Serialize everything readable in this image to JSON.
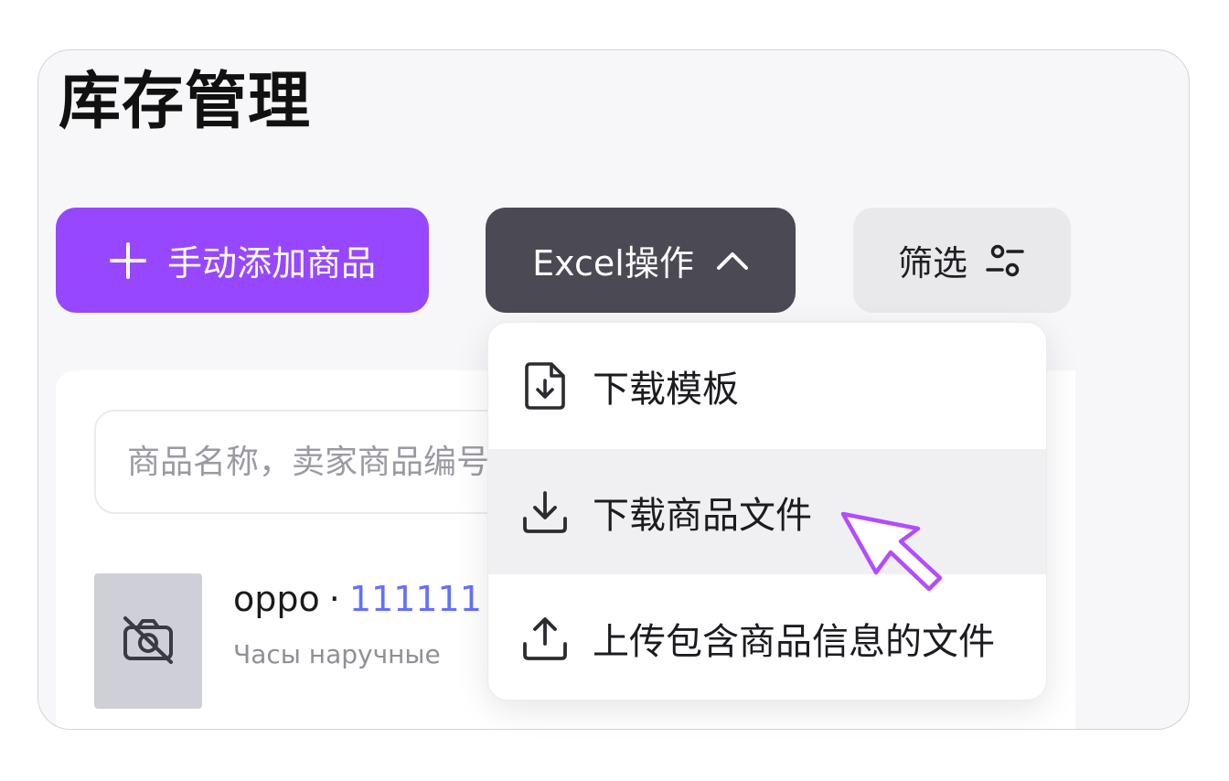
{
  "page": {
    "title": "库存管理"
  },
  "toolbar": {
    "add_label": "手动添加商品",
    "excel_label": "Excel操作",
    "filter_label": "筛选"
  },
  "search": {
    "placeholder": "商品名称，卖家商品编号，商品编号"
  },
  "product": {
    "name": "oppo",
    "separator": "·",
    "sku": "111111",
    "category": "Часы наручные"
  },
  "excel_menu": {
    "items": [
      {
        "label": "下载模板",
        "icon": "file-download-icon"
      },
      {
        "label": "下载商品文件",
        "icon": "download-icon"
      },
      {
        "label": "上传包含商品信息的文件",
        "icon": "upload-icon"
      }
    ]
  },
  "colors": {
    "accent": "#9747ff",
    "excel_button": "#4a4954",
    "filter_button": "#e9e9ec",
    "sku_link": "#6470ff"
  }
}
